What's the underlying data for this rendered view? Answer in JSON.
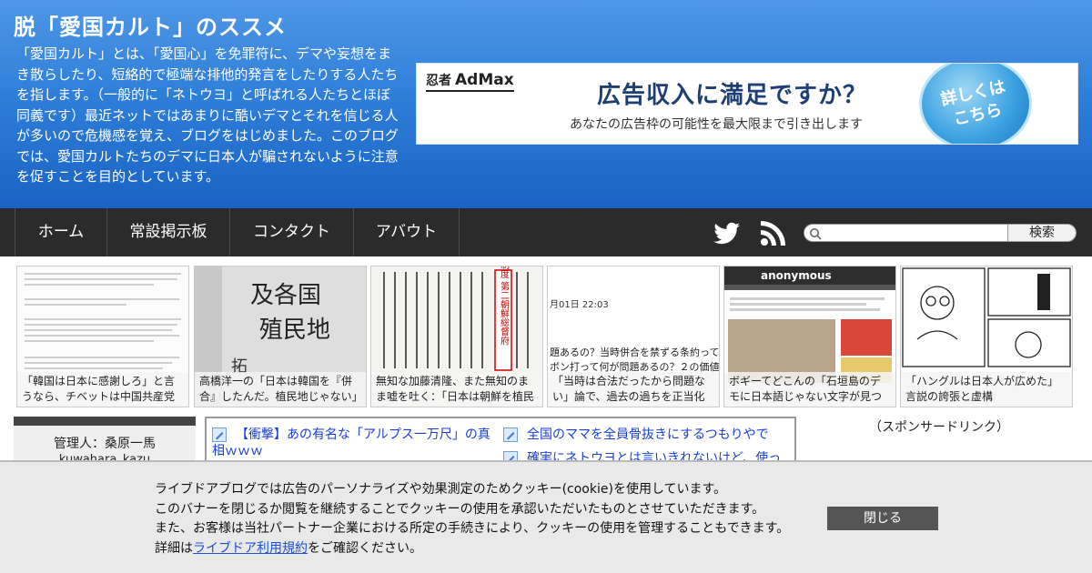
{
  "site": {
    "title": "脱「愛国カルト」のススメ",
    "description": "「愛国カルト」とは、「愛国心」を免罪符に、デマや妄想をまき散らしたり、短絡的で極端な排他的発言をしたりする人たちを指します。（一般的に「ネトウヨ」と呼ばれる人たちとほぼ同義です）最近ネットではあまりに酷いデマとそれを信じる人が多いので危機感を覚え、ブログをはじめました。このブログでは、愛国カルトたちのデマに日本人が騙されないように注意を促すことを目的としています。"
  },
  "ad": {
    "brand_small": "忍者",
    "brand": "AdMax",
    "headline": "広告収入に満足ですか？",
    "subline": "あなたの広告枠の可能性を最大限まで引き出します",
    "badge_line1": "詳しくは",
    "badge_line2": "こちら"
  },
  "nav": {
    "items": [
      {
        "label": "ホーム"
      },
      {
        "label": "常設掲示板"
      },
      {
        "label": "コンタクト"
      },
      {
        "label": "アバウト"
      }
    ],
    "search_button": "検索",
    "search_placeholder": ""
  },
  "featured": [
    {
      "caption": "「韓国は日本に感謝しろ」と言うなら、チベットは中国共産党に感謝しろ"
    },
    {
      "caption": "高橋洋一の「日本は韓国を『併合』したんだ。植民地じゃない」"
    },
    {
      "caption": "無知な加藤清隆、また無知のまま嘘を吐く：「日本は朝鮮を植民地"
    },
    {
      "caption": "「当時は合法だったから問題ない」論で、過去の過ちを正当化する"
    },
    {
      "caption": "ボギーてどこんの「石垣島のデモに日本語じゃない文字が見つかった"
    },
    {
      "caption": "「ハングルは日本人が広めた」言説の誇張と虚構"
    }
  ],
  "featured_thumbs": {
    "card3_text": "植民地ノ制度 第二朝鮮総督府",
    "card4_date": "月01日 22:03",
    "card4_line1": "題あるの？当時併合を禁ずる条約って",
    "card4_line2": "ボン打って何が問題あるの？２の価値",
    "card2_text1": "及各国",
    "card2_text2": "殖民地",
    "card2_text3": "拓",
    "card5_header": "anonymous"
  },
  "sidebar": {
    "admin_name": "管理人：桑原一馬",
    "admin_id": "kuwahara_kazu"
  },
  "feed": {
    "items": [
      {
        "title": "【衝撃】あの有名な「アルプス一万尺」の真相ｗｗｗ"
      },
      {
        "title": "全国のママを全員骨抜きにするつもりやで"
      },
      {
        "title": "確実にネトウヨとは言いきれないけど、使っ"
      }
    ]
  },
  "sponsored_label": "（スポンサードリンク）",
  "cookie": {
    "line1": "ライブドアブログでは広告のパーソナライズや効果測定のためクッキー(cookie)を使用しています。",
    "line2": "このバナーを閉じるか閲覧を継続することでクッキーの使用を承認いただいたものとさせていただきます。",
    "line3": "また、お客様は当社パートナー企業における所定の手続きにより、クッキーの使用を管理することもできます。",
    "line4_prefix": "詳細は",
    "line4_link": "ライブドア利用規約",
    "line4_suffix": "をご確認ください。",
    "close_label": "閉じる"
  },
  "colors": {
    "header_top": "#4f97e6",
    "header_bottom": "#1a63c4",
    "nav_bg": "#2b2b2b",
    "link": "#1a3fd6"
  }
}
